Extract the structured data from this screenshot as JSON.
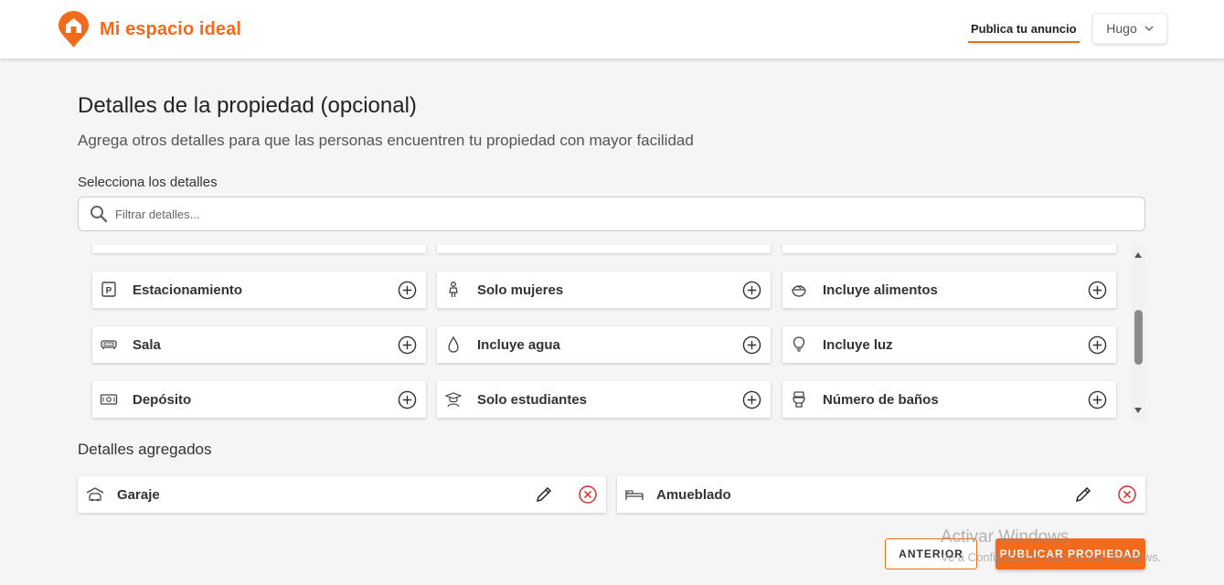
{
  "header": {
    "brand": "Mi espacio ideal",
    "publish_link": "Publica tu anuncio",
    "user_name": "Hugo",
    "accent_color": "#f26a1b"
  },
  "page": {
    "title": "Detalles de la propiedad (opcional)",
    "subtitle": "Agrega otros detalles para que las personas encuentren tu propiedad con mayor facilidad",
    "select_label": "Selecciona los detalles"
  },
  "search": {
    "placeholder": "Filtrar detalles...",
    "value": ""
  },
  "details_grid": {
    "items": [
      {
        "label": "Estacionamiento",
        "icon": "parking-icon"
      },
      {
        "label": "Solo mujeres",
        "icon": "woman-icon"
      },
      {
        "label": "Incluye alimentos",
        "icon": "food-bowl-icon"
      },
      {
        "label": "Sala",
        "icon": "sofa-icon"
      },
      {
        "label": "Incluye agua",
        "icon": "water-drop-icon"
      },
      {
        "label": "Incluye luz",
        "icon": "lightbulb-icon"
      },
      {
        "label": "Depósito",
        "icon": "cash-icon"
      },
      {
        "label": "Solo estudiantes",
        "icon": "student-icon"
      },
      {
        "label": "Número de baños",
        "icon": "toilet-icon"
      }
    ],
    "add_icon": "plus-circle-icon"
  },
  "added_details": {
    "label": "Detalles agregados",
    "items": [
      {
        "label": "Garaje",
        "icon": "car-garage-icon"
      },
      {
        "label": "Amueblado",
        "icon": "bed-icon"
      }
    ],
    "edit_icon": "pencil-icon",
    "remove_icon": "close-circle-icon",
    "remove_color": "#d32f2f"
  },
  "footer": {
    "prev_label": "ANTERIOR",
    "publish_label": "PUBLICAR PROPIEDAD"
  },
  "watermark": {
    "title": "Activar Windows",
    "subtitle": "Ve a Configuración para activar Windows."
  }
}
